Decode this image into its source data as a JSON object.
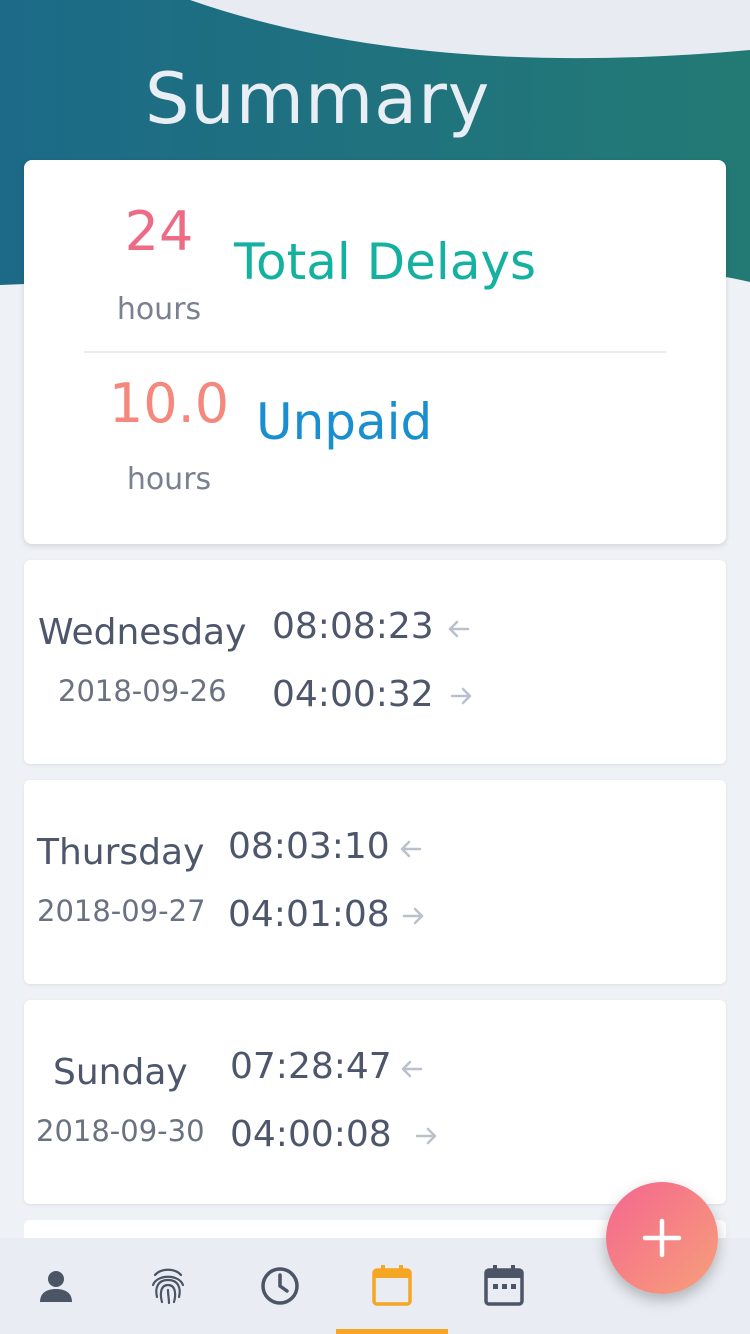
{
  "header": {
    "title": "Summary"
  },
  "summary": {
    "delays": {
      "value": "24",
      "unit": "hours",
      "label": "Total Delays"
    },
    "unpaid": {
      "value": "10.0",
      "unit": "hours",
      "label": "Unpaid"
    }
  },
  "days": [
    {
      "day": "Wednesday",
      "date": "2018-09-26",
      "in_time": "08:08:23",
      "out_time": "04:00:32"
    },
    {
      "day": "Thursday",
      "date": "2018-09-27",
      "in_time": "08:03:10",
      "out_time": "04:01:08"
    },
    {
      "day": "Sunday",
      "date": "2018-09-30",
      "in_time": "07:28:47",
      "out_time": "04:00:08"
    }
  ],
  "nav": {
    "items": [
      "person-icon",
      "fingerprint-icon",
      "clock-icon",
      "calendar-icon",
      "calendar-grid-icon"
    ],
    "active": "calendar-icon"
  },
  "fab": {
    "icon": "plus-icon"
  },
  "colors": {
    "header_start": "#1c6a88",
    "header_end": "#237a74",
    "accent_active": "#f5a623",
    "delay_value": "#ee6b86",
    "delay_label": "#14b0a0",
    "unpaid_label": "#1a8fd0"
  }
}
